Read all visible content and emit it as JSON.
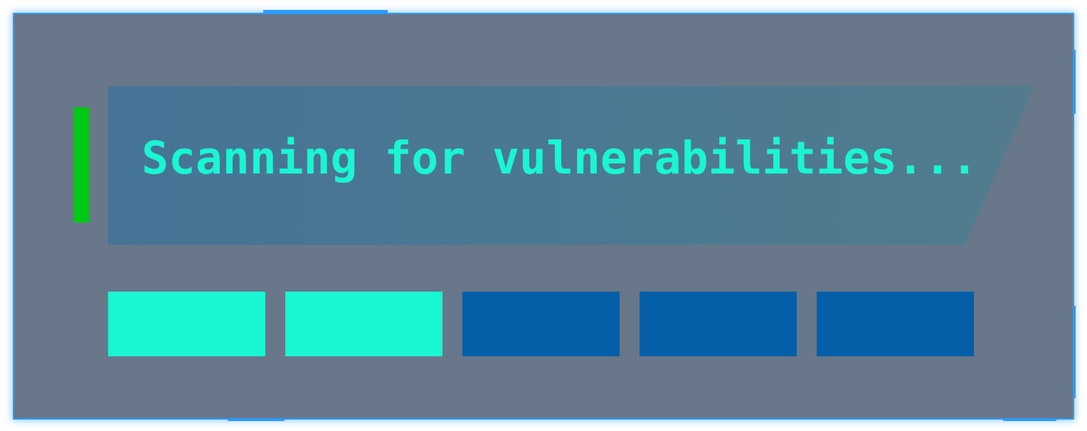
{
  "status": {
    "text": "Scanning for vulnerabilities..."
  },
  "progress": {
    "total_segments": 5,
    "filled_segments": 2,
    "filled_color": "#19f7d2",
    "empty_color": "#045fa8"
  },
  "colors": {
    "panel_background": "#687789",
    "frame_border": "#2b9bff",
    "indicator": "#00c814",
    "text": "#1af5d2"
  }
}
